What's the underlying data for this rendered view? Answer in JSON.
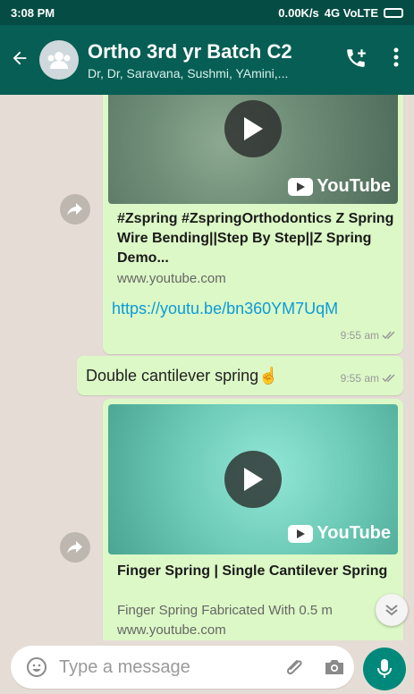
{
  "status": {
    "time": "3:08 PM",
    "network": "0.00K/s",
    "signal_label": "4G VoLTE"
  },
  "header": {
    "title": "Ortho 3rd yr Batch C2",
    "subtitle": "Dr, Dr, Saravana, Sushmi, YAmini,..."
  },
  "messages": [
    {
      "type": "link",
      "youtube_label": "YouTube",
      "title": "#Zspring #ZspringOrthodontics Z Spring Wire Bending||Step By Step||Z Spring Demo...",
      "domain": "www.youtube.com",
      "url": "https://youtu.be/bn360YM7UqM",
      "time": "9:55 am"
    },
    {
      "type": "text",
      "text": "Double cantilever spring☝",
      "time": "9:55 am"
    },
    {
      "type": "link",
      "youtube_label": "YouTube",
      "title": "Finger Spring | Single Cantilever Spring",
      "description": "Finger Spring Fabricated With 0.5 m",
      "domain": "www.youtube.com"
    }
  ],
  "compose": {
    "placeholder": "Type a message"
  },
  "colors": {
    "header": "#075e54",
    "status_bar": "#054d44",
    "bubble": "#dcf8c6",
    "link": "#0a9bd9",
    "mic": "#00897b"
  }
}
